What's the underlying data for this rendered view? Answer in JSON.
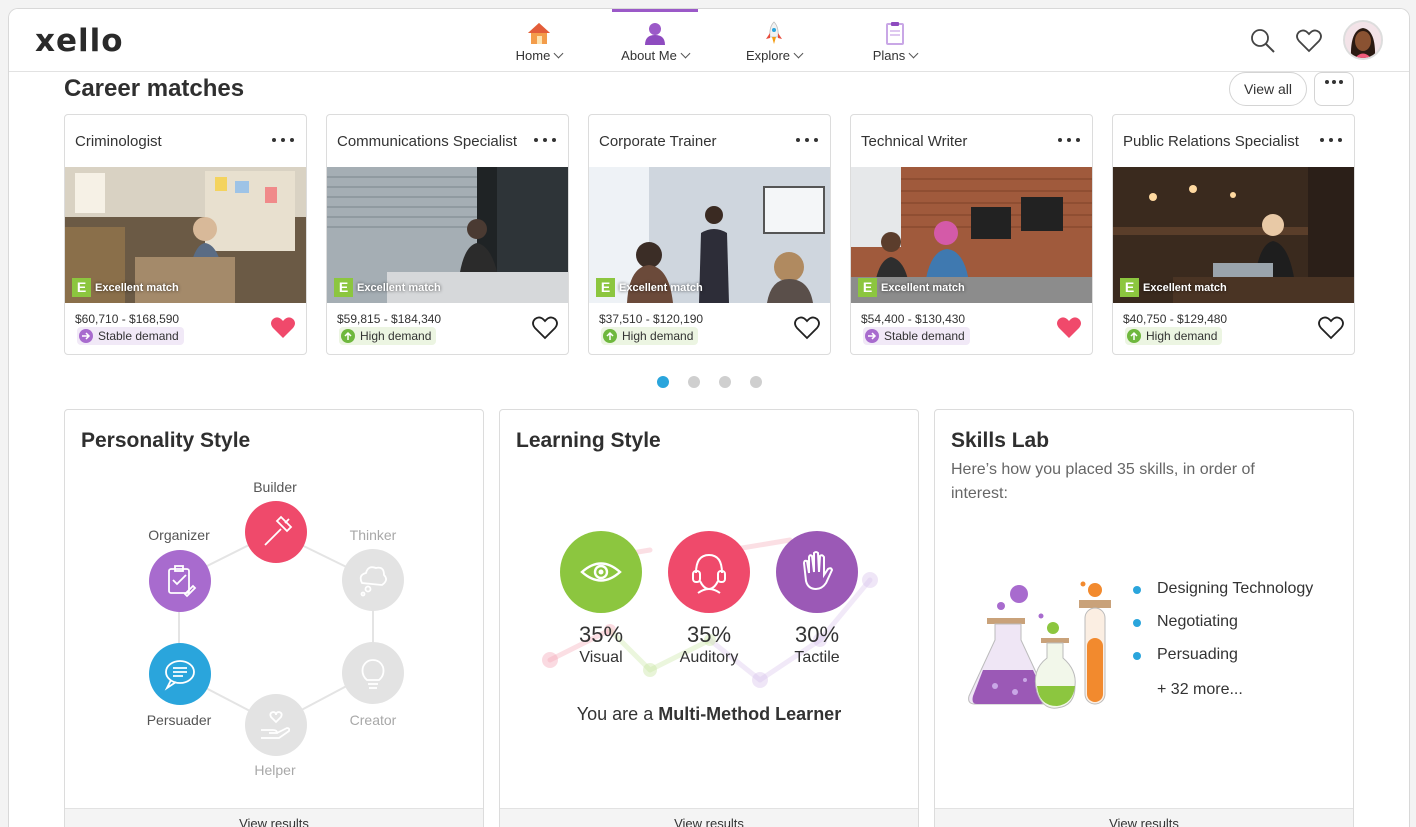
{
  "app": {
    "logo_text": "xello"
  },
  "nav": [
    {
      "label": "Home",
      "icon": "house-icon"
    },
    {
      "label": "About Me",
      "icon": "person-icon",
      "active": true
    },
    {
      "label": "Explore",
      "icon": "rocket-icon"
    },
    {
      "label": "Plans",
      "icon": "clipboard-icon"
    }
  ],
  "header_icons": [
    "search-icon",
    "heart-icon",
    "avatar"
  ],
  "career": {
    "title": "Career matches",
    "view_all": "View all",
    "cards": [
      {
        "title": "Criminologist",
        "match": "Excellent match",
        "salary": "$60,710 - $168,590",
        "demand": "Stable demand",
        "demand_type": "stable",
        "favorited": true
      },
      {
        "title": "Communications Specialist",
        "match": "Excellent match",
        "salary": "$59,815 - $184,340",
        "demand": "High demand",
        "demand_type": "high",
        "favorited": false
      },
      {
        "title": "Corporate Trainer",
        "match": "Excellent match",
        "salary": "$37,510 - $120,190",
        "demand": "High demand",
        "demand_type": "high",
        "favorited": false
      },
      {
        "title": "Technical Writer",
        "match": "Excellent match",
        "salary": "$54,400 - $130,430",
        "demand": "Stable demand",
        "demand_type": "stable",
        "favorited": true
      },
      {
        "title": "Public Relations Specialist",
        "match": "Excellent match",
        "salary": "$40,750 - $129,480",
        "demand": "High demand",
        "demand_type": "high",
        "favorited": false
      }
    ],
    "match_badge_letter": "E",
    "pager": {
      "pages": 4,
      "current": 1
    }
  },
  "personality": {
    "title": "Personality Style",
    "traits": [
      {
        "label": "Builder",
        "active": true,
        "color": "#ef4a6b",
        "icon": "hammer-icon"
      },
      {
        "label": "Thinker",
        "active": false,
        "color": "#e3e3e3",
        "icon": "thought-bubble-icon"
      },
      {
        "label": "Creator",
        "active": false,
        "color": "#e3e3e3",
        "icon": "lightbulb-icon"
      },
      {
        "label": "Helper",
        "active": false,
        "color": "#e3e3e3",
        "icon": "helping-hand-icon"
      },
      {
        "label": "Persuader",
        "active": true,
        "color": "#2aa5dc",
        "icon": "speech-bubble-icon"
      },
      {
        "label": "Organizer",
        "active": true,
        "color": "#a86bce",
        "icon": "clipboard-check-icon"
      }
    ],
    "footer": "View results"
  },
  "learning": {
    "title": "Learning Style",
    "styles": [
      {
        "name": "Visual",
        "percent": "35%",
        "value": 35,
        "color": "#8cc63f",
        "icon": "eye-icon"
      },
      {
        "name": "Auditory",
        "percent": "35%",
        "value": 35,
        "color": "#ef4a6b",
        "icon": "headset-icon"
      },
      {
        "name": "Tactile",
        "percent": "30%",
        "value": 30,
        "color": "#9b59b6",
        "icon": "hand-icon"
      }
    ],
    "summary_prefix": "You are a ",
    "summary_bold": "Multi-Method Learner",
    "footer": "View results"
  },
  "skills": {
    "title": "Skills Lab",
    "subtitle": "Here’s how you placed 35 skills, in order of interest:",
    "items": [
      "Designing Technology",
      "Negotiating",
      "Persuading"
    ],
    "more": "+ 32 more...",
    "footer": "View results"
  },
  "colors": {
    "accent_purple": "#9b59c8",
    "accent_blue": "#2aa5dc",
    "match_green": "#8cc63f",
    "heart_pink": "#f0496b"
  }
}
